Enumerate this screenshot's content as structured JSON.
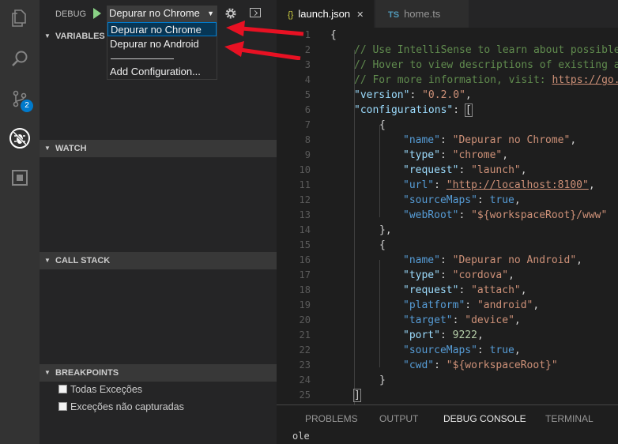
{
  "activity_bar": {
    "icons": [
      "files-icon",
      "search-icon",
      "source-control-icon",
      "debug-icon",
      "extensions-icon"
    ],
    "scm_badge": "2"
  },
  "debug_toolbar": {
    "label": "DEBUG",
    "selected_config": "Depurar no Chrome",
    "dropdown_options": [
      "Depurar no Chrome",
      "Depurar no Android",
      "——————",
      "Add Configuration..."
    ]
  },
  "sidebar": {
    "panels": {
      "variables": "VARIABLES",
      "watch": "WATCH",
      "call_stack": "CALL STACK",
      "breakpoints": "BREAKPOINTS"
    },
    "breakpoints": [
      "Todas Exceções",
      "Exceções não capturadas"
    ]
  },
  "editor_tabs": [
    {
      "icon": "{}",
      "label": "launch.json",
      "active": true
    },
    {
      "icon": "TS",
      "label": "home.ts",
      "active": false
    }
  ],
  "editor": {
    "line_numbers": [
      "1",
      "2",
      "3",
      "4",
      "5",
      "6",
      "7",
      "8",
      "9",
      "10",
      "11",
      "12",
      "13",
      "14",
      "15",
      "16",
      "17",
      "18",
      "19",
      "20",
      "21",
      "22",
      "23",
      "24",
      "25"
    ],
    "comments": [
      "// Use IntelliSense to learn about possible",
      "// Hover to view descriptions of existing at",
      "// For more information, visit: "
    ],
    "comment_link": "https://go.m",
    "version_key": "\"version\"",
    "version_value": "\"0.2.0\"",
    "configurations_key": "\"configurations\"",
    "config1": {
      "name": "\"Depurar no Chrome\"",
      "type": "\"chrome\"",
      "request": "\"launch\"",
      "url": "\"http://localhost:8100\"",
      "sourceMaps": "true",
      "webRoot": "\"${workspaceRoot}/www\""
    },
    "config2": {
      "name": "\"Depurar no Android\"",
      "type": "\"cordova\"",
      "request": "\"attach\"",
      "platform": "\"android\"",
      "target": "\"device\"",
      "port": "9222",
      "sourceMaps": "true",
      "cwd": "\"${workspaceRoot}\""
    }
  },
  "bottom_panel": {
    "tabs": [
      "PROBLEMS",
      "OUTPUT",
      "DEBUG CONSOLE",
      "TERMINAL"
    ],
    "active_tab": "DEBUG CONSOLE",
    "console_output": "ole"
  },
  "colors": {
    "accent": "#007acc",
    "arrow": "#e81123"
  }
}
